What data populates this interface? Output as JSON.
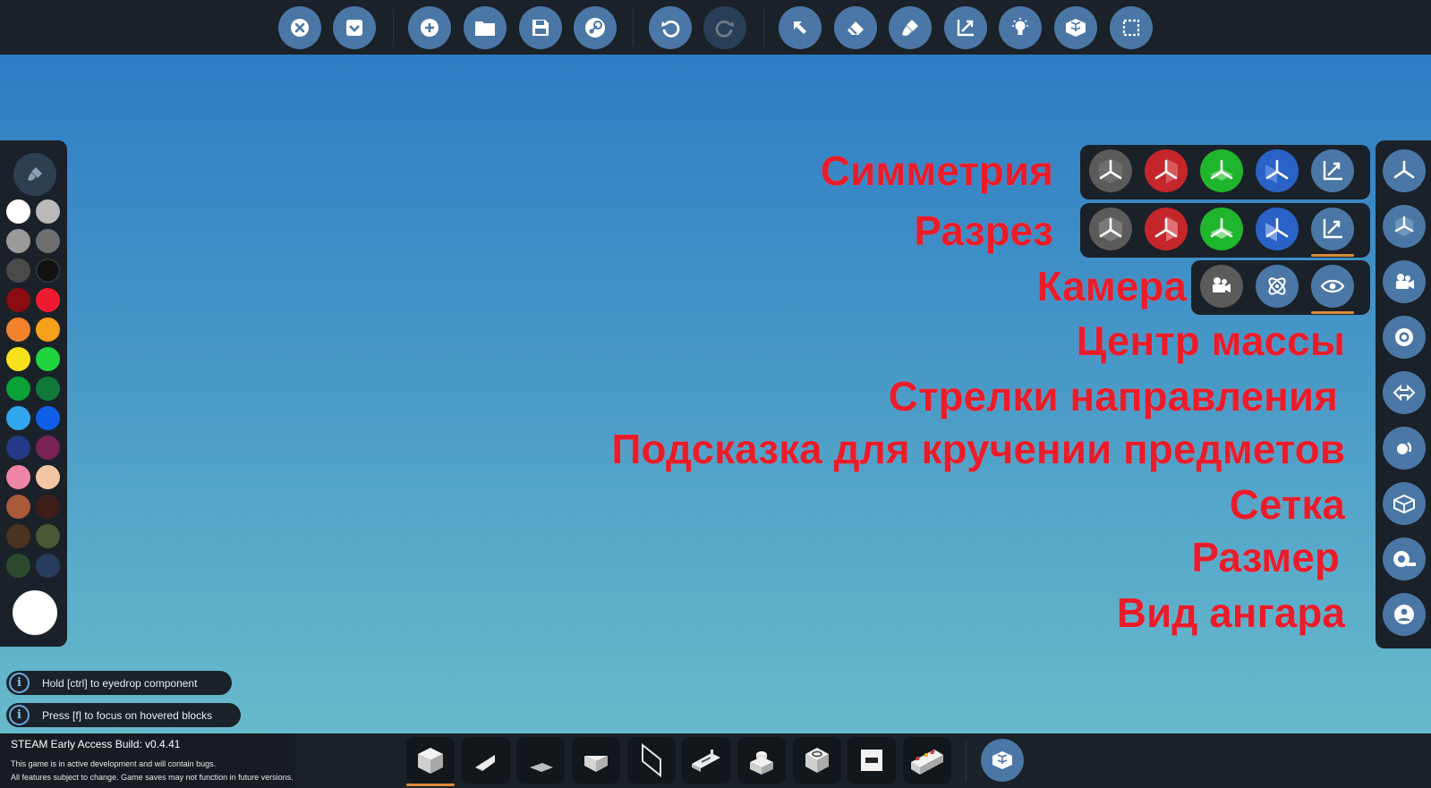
{
  "colors": {
    "bar_bg": "#1b2128",
    "button_blue": "#4a77a6",
    "accent_orange": "#d98a3a",
    "label_red": "#ea1c2a",
    "sky_top": "#2a78c4",
    "sky_bottom": "#6cbfcc"
  },
  "toolbar": {
    "icons": [
      "close-icon",
      "dropdown-icon",
      "add-icon",
      "folder-icon",
      "save-icon",
      "steam-icon",
      "undo-icon",
      "redo-icon",
      "select-arrow-icon",
      "eraser-icon",
      "paint-brush-icon",
      "scale-icon",
      "light-bulb-icon",
      "parts-icon",
      "selection-box-icon"
    ]
  },
  "palette": {
    "swatches": [
      "#ffffff",
      "#b9b9b9",
      "#9a9a9a",
      "#6f6f6f",
      "#4a4a4a",
      "#111111",
      "#8b0d12",
      "#ee1b2e",
      "#f2832c",
      "#f7a01c",
      "#f6e11a",
      "#1fd43f",
      "#0aa236",
      "#0f7a3a",
      "#2fa6ee",
      "#0e5ee8",
      "#243a86",
      "#7a2255",
      "#ef86a8",
      "#f3c6a3",
      "#a85a3a",
      "#3d1e1a",
      "#4a3320",
      "#4a5a34",
      "#2e4a2e",
      "#283c5e"
    ],
    "selected": "#ffffff"
  },
  "hints": [
    {
      "text": "Hold [ctrl] to eyedrop component"
    },
    {
      "text": "Press [f] to focus on hovered blocks"
    }
  ],
  "build": {
    "title": "STEAM Early Access Build: v0.4.41",
    "line1": "This game is in active development and will contain bugs.",
    "line2": "All features subject to change. Game saves may not function in future versions."
  },
  "blocks": [
    "cube-block-icon",
    "wedge-block-icon",
    "slope-block-icon",
    "inverted-wedge-block-icon",
    "panel-block-icon",
    "rail-block-icon",
    "button-block-icon",
    "socket-block-icon",
    "window-block-icon",
    "control-block-icon"
  ],
  "labels": {
    "symmetry": "Симметрия",
    "section": "Разрез",
    "camera": "Камера",
    "center_of_mass": "Центр массы",
    "direction_arrows": "Стрелки направления",
    "rotation_hint": "Подсказка для кручении предметов",
    "grid": "Сетка",
    "size": "Размер",
    "hangar_view": "Вид ангара"
  },
  "symmetry_row": {
    "buttons": [
      {
        "icon": "axis-none-icon",
        "color": "#5b5b5b",
        "selected": true
      },
      {
        "icon": "axis-x-icon",
        "color": "#c4262b",
        "selected": false
      },
      {
        "icon": "axis-y-icon",
        "color": "#1fb52c",
        "selected": false
      },
      {
        "icon": "axis-z-icon",
        "color": "#2a62c7",
        "selected": false
      },
      {
        "icon": "scale-icon",
        "color": "#4a77a6",
        "selected": false
      }
    ]
  },
  "section_row": {
    "buttons": [
      {
        "icon": "section-none-icon",
        "color": "#5b5b5b",
        "selected": true
      },
      {
        "icon": "section-x-icon",
        "color": "#c4262b",
        "selected": false
      },
      {
        "icon": "section-y-icon",
        "color": "#1fb52c",
        "selected": false
      },
      {
        "icon": "section-z-icon",
        "color": "#2a62c7",
        "selected": false
      },
      {
        "icon": "scale-icon",
        "color": "#4a77a6",
        "selected": true
      }
    ]
  },
  "camera_row": {
    "buttons": [
      {
        "icon": "video-camera-icon",
        "color": "#5b5b5b",
        "selected": false
      },
      {
        "icon": "orbit-icon",
        "color": "#4a77a6",
        "selected": false
      },
      {
        "icon": "eye-icon",
        "color": "#4a77a6",
        "selected": true
      }
    ]
  }
}
